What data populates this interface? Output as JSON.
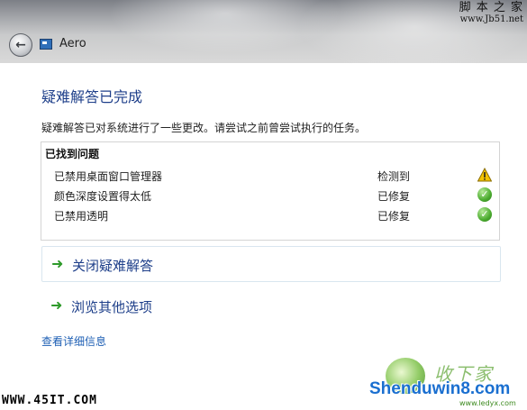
{
  "watermarks": {
    "top_right_line1": "脚 本 之 家",
    "top_right_line2": "www.Jb51.net",
    "bottom_left": "WWW.45IT.COM",
    "bottom_right_site": "Shenduwin8.com",
    "bottom_right_sub": "www.ledyx.com",
    "bottom_right_calligraphy": "收下家"
  },
  "window": {
    "title": "Aero"
  },
  "page": {
    "heading": "疑难解答已完成",
    "description": "疑难解答已对系统进行了一些更改。请尝试之前曾尝试执行的任务。"
  },
  "problems": {
    "header": "已找到问题",
    "rows": [
      {
        "name": "已禁用桌面窗口管理器",
        "status": "检测到",
        "icon": "warning-icon"
      },
      {
        "name": "颜色深度设置得太低",
        "status": "已修复",
        "icon": "check-icon"
      },
      {
        "name": "已禁用透明",
        "status": "已修复",
        "icon": "check-icon"
      }
    ]
  },
  "options": [
    {
      "label": "关闭疑难解答"
    },
    {
      "label": "浏览其他选项"
    }
  ],
  "details_link": "查看详细信息",
  "colors": {
    "heading": "#1e3f8a",
    "link": "#1e5fb4",
    "ok_green": "#4bab2f",
    "warning_yellow": "#f2c200"
  }
}
